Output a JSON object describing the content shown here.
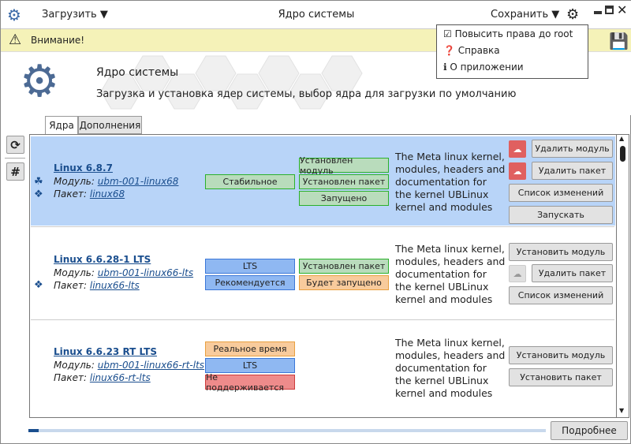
{
  "titlebar": {
    "title": "Ядро системы",
    "load_menu": "Загрузить",
    "save_menu": "Сохранить"
  },
  "menu": {
    "items": [
      {
        "label": "Повысить права до root",
        "icon": "checkbox-icon"
      },
      {
        "label": "Справка",
        "icon": "question-icon"
      },
      {
        "label": "О приложении",
        "icon": "info-icon"
      }
    ]
  },
  "warning": {
    "text": "Внимание!"
  },
  "header": {
    "title": "Ядро системы",
    "subtitle": "Загрузка и установка ядер системы, выбор ядра для загрузки по умолчанию"
  },
  "tabs": [
    {
      "label": "Ядра",
      "active": true
    },
    {
      "label": "Дополнения",
      "active": false
    }
  ],
  "colors": {
    "selected_row": "#b8d4f8",
    "accent": "#1a4e8e",
    "warning_bg": "#f5f2b8"
  },
  "kernels": [
    {
      "name": "Linux 6.8.7",
      "module_label": "Модуль:",
      "module": "ubm-001-linux68",
      "package_label": "Пакет:",
      "package": "linux68",
      "selected": true,
      "tags": [
        "Стабильное"
      ],
      "status": [
        "Установлен модуль",
        "Установлен пакет",
        "Запущено"
      ],
      "description": "The Meta linux kernel, modules, headers and documentation for the kernel UBLinux kernel and modules",
      "actions": [
        "Удалить модуль",
        "Удалить пакет",
        "Список изменений",
        "Запускать"
      ]
    },
    {
      "name": "Linux 6.6.28-1 LTS",
      "module_label": "Модуль:",
      "module": "ubm-001-linux66-lts",
      "package_label": "Пакет:",
      "package": "linux66-lts",
      "tags": [
        "LTS",
        "Рекомендуется"
      ],
      "status": [
        "Установлен пакет",
        "Будет запущено"
      ],
      "description": "The Meta linux kernel, modules, headers and documentation for the kernel UBLinux kernel and modules",
      "actions": [
        "Установить модуль",
        "Удалить пакет",
        "Список изменений"
      ]
    },
    {
      "name": "Linux 6.6.23 RT LTS",
      "module_label": "Модуль:",
      "module": "ubm-001-linux66-rt-lts",
      "package_label": "Пакет:",
      "package": "linux66-rt-lts",
      "tags": [
        "Реальное время",
        "LTS",
        "Не поддерживается"
      ],
      "status": [],
      "description": "The Meta linux kernel, modules, headers and documentation for the kernel UBLinux kernel and modules",
      "actions": [
        "Установить модуль",
        "Установить пакет"
      ]
    }
  ],
  "footer": {
    "details_button": "Подробнее",
    "progress_percent": 2
  }
}
